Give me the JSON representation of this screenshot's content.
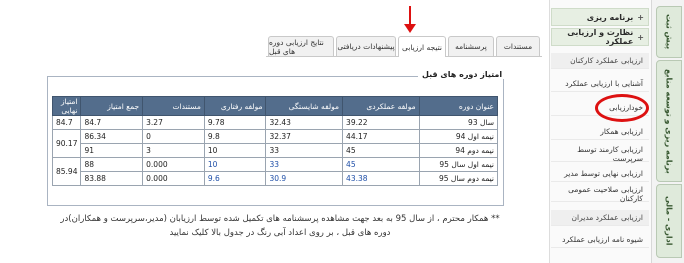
{
  "rail": {
    "tabs": [
      {
        "label": "پیش ثبت"
      },
      {
        "label": "برنامه ریزی و توسعه منابع"
      },
      {
        "label": "اداری - مالی"
      }
    ]
  },
  "sidebar": {
    "heads": [
      {
        "label": "برنامه ریزی"
      },
      {
        "label": "نظارت و ارزیابی عملکرد"
      }
    ],
    "items": [
      {
        "label": "ارزیابی عملکرد کارکنان"
      },
      {
        "label": "آشنایی با ارزیابی عملکرد"
      },
      {
        "label": "خودارزیابی"
      },
      {
        "label": "ارزیابی همکار"
      },
      {
        "label": "ارزیابی کارمند توسط سرپرست"
      },
      {
        "label": "ارزیابی نهایی توسط مدیر"
      },
      {
        "label": "ارزیابی صلاحیت عمومی کارکنان"
      },
      {
        "label": "ارزیابی عملکرد مدیران"
      },
      {
        "label": "شیوه نامه ارزیابی عملکرد"
      }
    ]
  },
  "tabs": [
    {
      "label": "مستندات"
    },
    {
      "label": "پرسشنامه"
    },
    {
      "label": "نتیجه ارزیابی"
    },
    {
      "label": "پیشنهادات دریافتی"
    },
    {
      "label": "نتایج ارزیابی دوره های قبل"
    }
  ],
  "panel": {
    "title": "امتیاز دوره های قبل"
  },
  "table": {
    "headers": [
      "عنوان دوره",
      "مولفه عملکردی",
      "مولفه شایستگی",
      "مولفه رفتاری",
      "مستندات",
      "جمع امتیاز",
      "امتیاز نهایی"
    ],
    "rows": [
      {
        "period": "سال 93",
        "performance": "39.22",
        "competency": "32.43",
        "behavior": "9.78",
        "docs": "3.27",
        "total": "84.7",
        "final": "84.7"
      },
      {
        "period": "نیمه اول 94",
        "performance": "44.17",
        "competency": "32.37",
        "behavior": "9.8",
        "docs": "0",
        "total": "86.34",
        "final": "90.17"
      },
      {
        "period": "نیمه دوم 94",
        "performance": "45",
        "competency": "33",
        "behavior": "10",
        "docs": "3",
        "total": "91",
        "final": ""
      },
      {
        "period": "نیمه اول سال 95",
        "performance": "45",
        "competency": "33",
        "behavior": "10",
        "docs": "0.000",
        "total": "88",
        "final": "85.94"
      },
      {
        "period": "نیمه دوم سال 95",
        "performance": "43.38",
        "competency": "30.9",
        "behavior": "9.6",
        "docs": "0.000",
        "total": "83.88",
        "final": ""
      }
    ]
  },
  "note": {
    "text": "** همکار محترم ، از سال 95 به بعد جهت مشاهده پرسشنامه های تکمیل شده توسط ارزیابان (مدیر،سرپرست و همکاران)در دوره های قبل ، بر روی اعداد آبی رنگ در جدول بالا کلیک نمایید"
  },
  "colors": {
    "header_bg": "#536d8c",
    "link_blue": "#1f4fa8",
    "annotation_red": "#d11111"
  }
}
